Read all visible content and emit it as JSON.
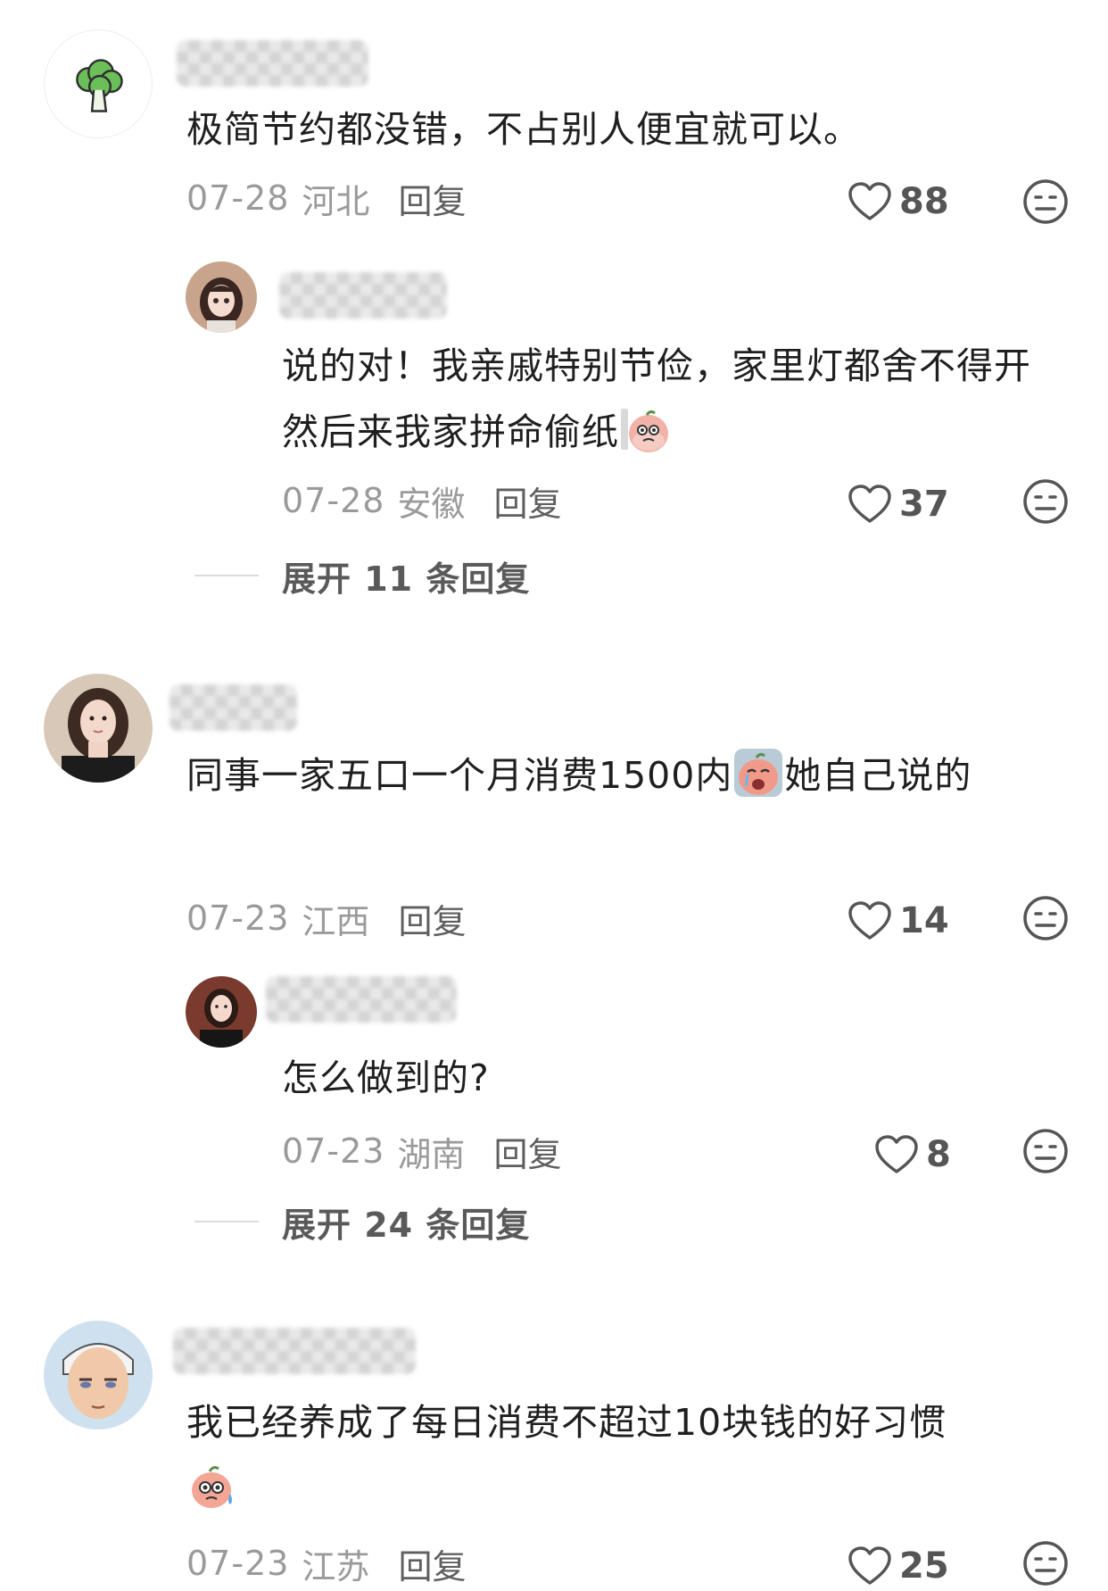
{
  "comments": [
    {
      "text": "极简节约都没错，不占别人便宜就可以。",
      "date": "07-28",
      "location": "河北",
      "reply_label": "回复",
      "likes": "88",
      "avatar_icon": "broccoli-icon",
      "replies": [
        {
          "text": "说的对！我亲戚特别节俭，家里灯都舍不得开然后来我家拼命偷纸",
          "emoji": "sneaky-peach-emoji-icon",
          "date": "07-28",
          "location": "安徽",
          "reply_label": "回复",
          "likes": "37"
        }
      ],
      "expand_label": "展开 11 条回复"
    },
    {
      "text_before_emoji": "同事一家五口一个月消费1500内",
      "emoji": "crying-peach-emoji-icon",
      "text_after_emoji": "她自己说的",
      "date": "07-23",
      "location": "江西",
      "reply_label": "回复",
      "likes": "14",
      "replies": [
        {
          "text": "怎么做到的?",
          "date": "07-23",
          "location": "湖南",
          "reply_label": "回复",
          "likes": "8"
        }
      ],
      "expand_label": "展开 24 条回复"
    },
    {
      "text": "我已经养成了每日消费不超过10块钱的好习惯",
      "emoji": "sweating-peach-emoji-icon",
      "date": "07-23",
      "location": "江苏",
      "reply_label": "回复",
      "likes": "25"
    }
  ],
  "colors": {
    "meta_text": "#9a9a9a",
    "body_text": "#1f1f1f",
    "icon_stroke": "#555555"
  }
}
